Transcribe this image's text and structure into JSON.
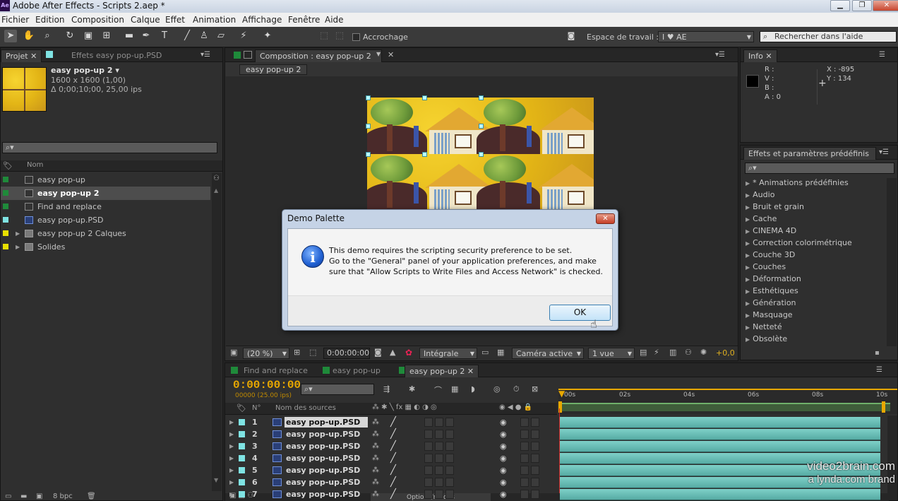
{
  "window": {
    "title": "Adobe After Effects - Scripts 2.aep *",
    "app_icon": "Ae"
  },
  "menu": [
    "Fichier",
    "Edition",
    "Composition",
    "Calque",
    "Effet",
    "Animation",
    "Affichage",
    "Fenêtre",
    "Aide"
  ],
  "toolbar": {
    "snapping_label": "Accrochage",
    "workspace_label": "Espace de travail :",
    "workspace_value": "I ♥ AE",
    "help_search_placeholder": "Rechercher dans l'aide"
  },
  "project": {
    "tabs": [
      "Projet",
      "Effets easy pop-up.PSD"
    ],
    "selected_name": "easy pop-up 2 ▾",
    "selected_size": "1600 x 1600 (1,00)",
    "selected_duration": "Δ 0;00;10;00, 25,00 ips",
    "column_name": "Nom",
    "items": [
      {
        "name": "easy pop-up",
        "color": "#1f8a3a"
      },
      {
        "name": "easy pop-up 2",
        "color": "#1f8a3a"
      },
      {
        "name": "Find and replace",
        "color": "#1f8a3a"
      },
      {
        "name": "easy pop-up.PSD",
        "color": "#7fe3e3"
      },
      {
        "name": "easy pop-up 2 Calques",
        "color": "#e8e000"
      },
      {
        "name": "Solides",
        "color": "#e8e000"
      }
    ],
    "footer_bpc": "8 bpc"
  },
  "composition": {
    "tab_label": "Composition : easy pop-up 2",
    "breadcrumb": "easy pop-up 2",
    "zoom": "(20 %)",
    "timecode": "0:00:00:00",
    "resolution": "Intégrale",
    "camera": "Caméra active",
    "views": "1 vue",
    "exposure": "+0,0"
  },
  "info": {
    "tab": "Info",
    "r": "R :",
    "v": "V :",
    "b": "B :",
    "a": "A : 0",
    "x": "X : -895",
    "y": "Y : 134"
  },
  "effects": {
    "tab": "Effets et paramètres prédéfinis",
    "items": [
      "* Animations prédéfinies",
      "Audio",
      "Bruit et grain",
      "Cache",
      "CINEMA 4D",
      "Correction colorimétrique",
      "Couche 3D",
      "Couches",
      "Déformation",
      "Esthétiques",
      "Génération",
      "Masquage",
      "Netteté",
      "Obsolète"
    ]
  },
  "timeline": {
    "tabs": [
      "Find and replace",
      "easy pop-up",
      "easy pop-up 2"
    ],
    "timecode": "0:00:00:00",
    "frames": "00000 (25.00 ips)",
    "col_num": "N°",
    "col_source": "Nom des sources",
    "ruler": [
      "00s",
      "02s",
      "04s",
      "06s",
      "08s",
      "10s"
    ],
    "layers": [
      {
        "num": "1",
        "name": "easy pop-up.PSD"
      },
      {
        "num": "2",
        "name": "easy pop-up.PSD"
      },
      {
        "num": "3",
        "name": "easy pop-up.PSD"
      },
      {
        "num": "4",
        "name": "easy pop-up.PSD"
      },
      {
        "num": "5",
        "name": "easy pop-up.PSD"
      },
      {
        "num": "6",
        "name": "easy pop-up.PSD"
      },
      {
        "num": "7",
        "name": "easy pop-up.PSD"
      }
    ],
    "options_label": "Options/modes"
  },
  "dialog": {
    "title": "Demo Palette",
    "line1": "This demo requires the scripting security preference to be set.",
    "line2": "Go to the \"General\" panel of your application preferences, and make",
    "line3": "sure that \"Allow Scripts to Write Files and Access Network\" is checked.",
    "ok": "OK"
  },
  "watermark": {
    "line1": "video2brain.com",
    "line2": "a lynda.com brand"
  }
}
